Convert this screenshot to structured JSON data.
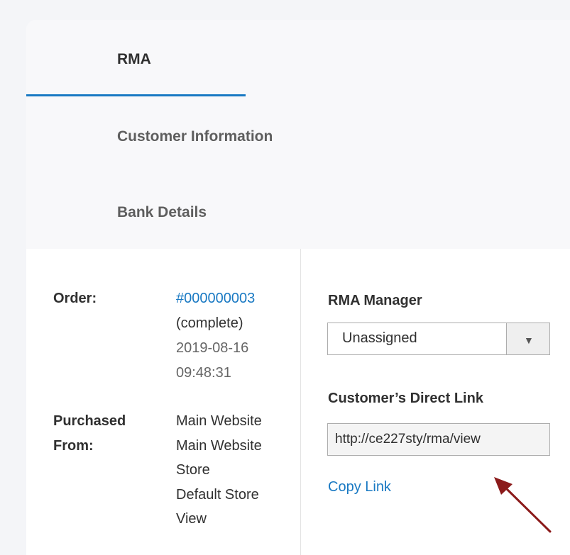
{
  "tabs": [
    {
      "label": "RMA"
    },
    {
      "label": "Customer Information"
    },
    {
      "label": "Bank Details"
    }
  ],
  "order": {
    "label": "Order:",
    "number": "#000000003",
    "status": "(complete)",
    "date": "2019-08-16",
    "time": "09:48:31"
  },
  "purchased": {
    "label_line1": "Purchased",
    "label_line2": "From:",
    "lines": [
      "Main Website",
      "Main Website",
      "Store",
      "Default Store",
      "View"
    ]
  },
  "rma_manager": {
    "label": "RMA Manager",
    "selected": "Unassigned"
  },
  "direct_link": {
    "label": "Customer’s Direct Link",
    "value": "http://ce227sty/rma/view",
    "copy_label": "Copy Link"
  },
  "colors": {
    "accent": "#1979c3",
    "arrow": "#8b1a1a"
  }
}
